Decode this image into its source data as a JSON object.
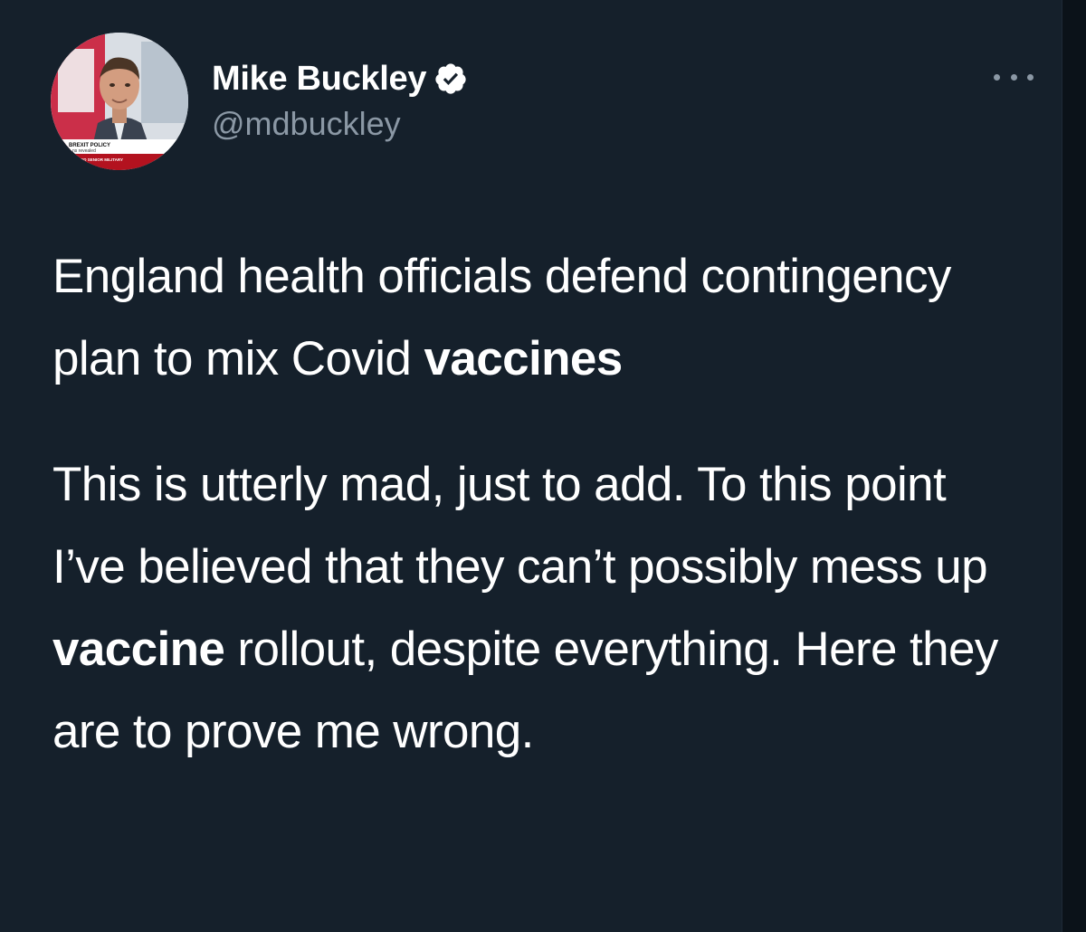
{
  "author": {
    "name": "Mike Buckley",
    "handle": "@mdbuckley",
    "verified": true,
    "verified_color": "#ffffff"
  },
  "avatar": {
    "caption_line1": "BREXIT POLICY",
    "caption_line2": "ns revealed",
    "ticker": "SE ED SENIOR MILITARY"
  },
  "menu": {
    "icon": "more-horizontal-icon"
  },
  "tweet": {
    "headline": {
      "text": "England health officials defend contingency plan to mix Covid ",
      "bold": "vaccines"
    },
    "comment": {
      "part1": "This is utterly mad, just to add. To this point I’ve believed that they can’t possibly mess up ",
      "bold": "vaccine",
      "part2": " rollout, despite everything. Here they are to prove me wrong."
    }
  },
  "colors": {
    "background": "#15202b",
    "text": "#ffffff",
    "secondary_text": "#8b98a5"
  }
}
